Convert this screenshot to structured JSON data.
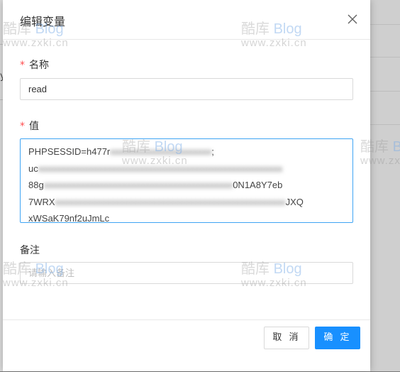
{
  "dialog": {
    "title": "编辑变量",
    "fields": {
      "name": {
        "required_mark": "*",
        "label": "名称",
        "value": "read"
      },
      "value": {
        "required_mark": "*",
        "label": "值",
        "visible_text": [
          "PHPSESSID=h477r",
          ";",
          "uc",
          "88g",
          "0N1A8Y7eb",
          "7WRX",
          "JXQ",
          "xWSaK79nf2uJmLc"
        ]
      },
      "note": {
        "label": "备注",
        "placeholder": "请输入备注"
      }
    },
    "buttons": {
      "cancel": "取 消",
      "ok": "确 定"
    }
  },
  "watermark": {
    "brand_cn": "酷库",
    "brand_en": "Blog",
    "url": "www.zxki.cn"
  },
  "background": {
    "partial_text": "y"
  }
}
